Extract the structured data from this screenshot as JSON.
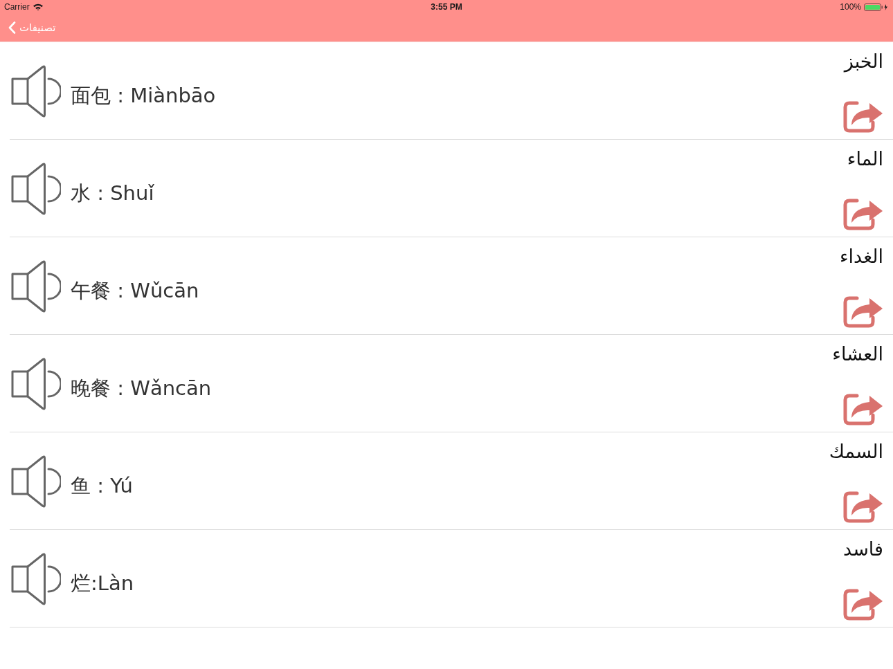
{
  "status_bar": {
    "carrier": "Carrier",
    "time": "3:55 PM",
    "battery": "100%"
  },
  "nav_bar": {
    "back_label": "تصنيفات"
  },
  "rows": [
    {
      "arabic": "الخبز",
      "chinese": "面包 : Miànbāo"
    },
    {
      "arabic": "الماء",
      "chinese": "水 : Shuǐ"
    },
    {
      "arabic": "الغداء",
      "chinese": "午餐 : Wǔcān"
    },
    {
      "arabic": "العشاء",
      "chinese": "晚餐 : Wǎncān"
    },
    {
      "arabic": "السمك",
      "chinese": "鱼 : Yú"
    },
    {
      "arabic": "فاسد",
      "chinese": "烂:Làn"
    }
  ]
}
